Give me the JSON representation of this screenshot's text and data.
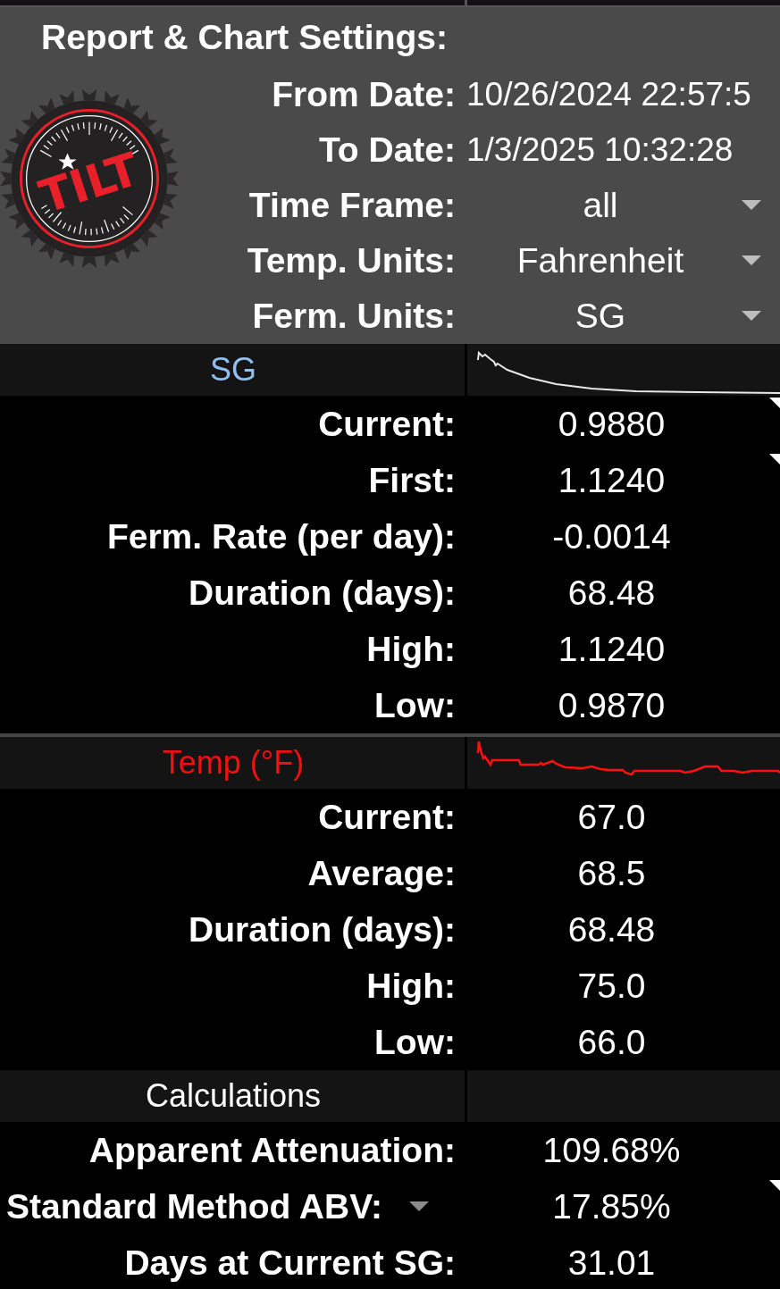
{
  "settings": {
    "title": "Report & Chart Settings:",
    "logo_text": "TILT",
    "rows": [
      {
        "label": "From Date:",
        "value": "10/26/2024 22:57:5",
        "dropdown": false
      },
      {
        "label": "To Date:",
        "value": "1/3/2025 10:32:28",
        "dropdown": false
      },
      {
        "label": "Time Frame:",
        "value": "all",
        "dropdown": true
      },
      {
        "label": "Temp. Units:",
        "value": "Fahrenheit",
        "dropdown": true
      },
      {
        "label": "Ferm. Units:",
        "value": "SG",
        "dropdown": true
      }
    ]
  },
  "sections": [
    {
      "title": "SG",
      "color": "#8fbff0",
      "rows": [
        {
          "label": "Current:",
          "value": "0.9880",
          "marker": true,
          "label_dropdown": false
        },
        {
          "label": "First:",
          "value": "1.1240",
          "marker": true,
          "label_dropdown": false
        },
        {
          "label": "Ferm. Rate (per day):",
          "value": "-0.0014",
          "marker": false,
          "label_dropdown": false
        },
        {
          "label": "Duration (days):",
          "value": "68.48",
          "marker": false,
          "label_dropdown": false
        },
        {
          "label": "High:",
          "value": "1.1240",
          "marker": false,
          "label_dropdown": false
        },
        {
          "label": "Low:",
          "value": "0.9870",
          "marker": false,
          "label_dropdown": false
        }
      ]
    },
    {
      "title": "Temp (°F)",
      "color": "#f01010",
      "rows": [
        {
          "label": "Current:",
          "value": "67.0",
          "marker": false,
          "label_dropdown": false
        },
        {
          "label": "Average:",
          "value": "68.5",
          "marker": false,
          "label_dropdown": false
        },
        {
          "label": "Duration (days):",
          "value": "68.48",
          "marker": false,
          "label_dropdown": false
        },
        {
          "label": "High:",
          "value": "75.0",
          "marker": false,
          "label_dropdown": false
        },
        {
          "label": "Low:",
          "value": "66.0",
          "marker": false,
          "label_dropdown": false
        }
      ]
    },
    {
      "title": "Calculations",
      "color": "#ffffff",
      "rows": [
        {
          "label": "Apparent Attenuation:",
          "value": "109.68%",
          "marker": false,
          "label_dropdown": false
        },
        {
          "label": "Standard Method ABV:",
          "value": "17.85%",
          "marker": true,
          "label_dropdown": true
        },
        {
          "label": "Days at Current SG:",
          "value": "31.01",
          "marker": false,
          "label_dropdown": false
        }
      ]
    }
  ]
}
